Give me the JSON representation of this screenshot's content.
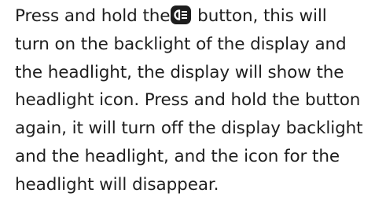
{
  "instructions": {
    "line1_before": "Press and hold the",
    "button_icon": "headlight-button-icon",
    "line1_after": " button, this will",
    "line2": "turn on the backlight of the display and",
    "line3": "the headlight, the display will show the",
    "line4": "headlight icon. Press and hold the button",
    "line5": "again, it will turn off the display backlight",
    "line6": "and the headlight, and the icon for the",
    "line7": "headlight will disappear."
  }
}
